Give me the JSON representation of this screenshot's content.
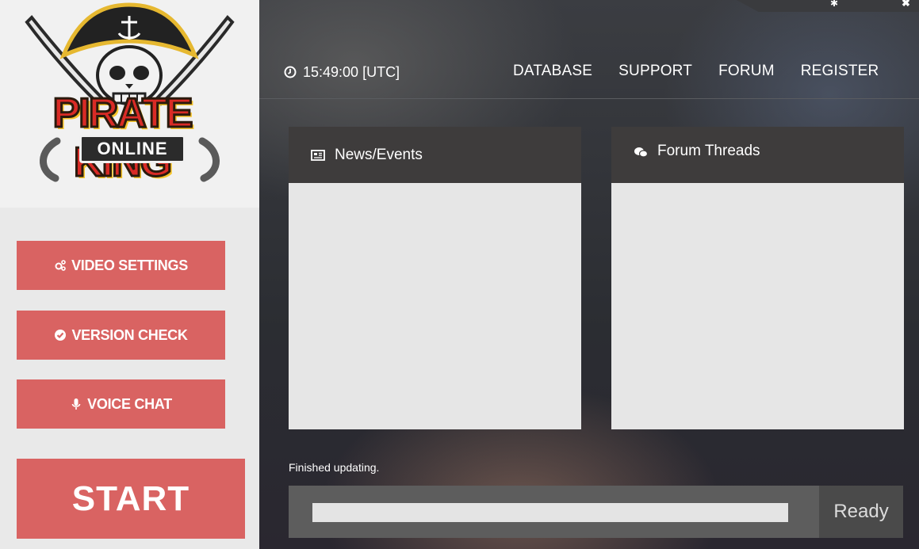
{
  "logo": {
    "title": "PIRATE KING",
    "subtitle": "ONLINE"
  },
  "sidebar": {
    "video_settings_label": "VIDEO SETTINGS",
    "version_check_label": "VERSION CHECK",
    "voice_chat_label": "VOICE CHAT",
    "start_label": "START"
  },
  "header": {
    "clock": "15:49:00 [UTC]",
    "nav": [
      "DATABASE",
      "SUPPORT",
      "FORUM",
      "REGISTER"
    ]
  },
  "panels": {
    "news_title": "News/Events",
    "forum_title": "Forum Threads"
  },
  "status": {
    "message": "Finished updating.",
    "progress": 1.0,
    "state": "Ready"
  },
  "colors": {
    "accent": "#d96362",
    "panel_header": "#3e3c3c",
    "panel_body": "#e6e6e6",
    "progress_bg": "#5d5d5d"
  }
}
